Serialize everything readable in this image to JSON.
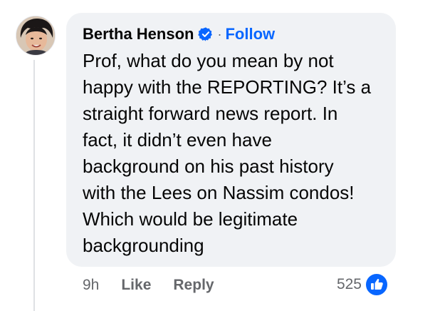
{
  "comment": {
    "author": "Bertha Henson",
    "verified_icon": "verified-badge-icon",
    "separator": "·",
    "follow_label": "Follow",
    "text": "Prof, what do you mean by not\nhappy with the REPORTING? It’s a\nstraight forward news report. In\nfact, it didn’t even have\nbackground on his past history\nwith the Lees on Nassim condos!\nWhich would be legitimate\nbackgrounding",
    "time": "9h",
    "like_label": "Like",
    "reply_label": "Reply",
    "reaction_count": "525",
    "reaction_icon": "thumbs-up-icon"
  },
  "colors": {
    "bubble_bg": "#f0f2f5",
    "accent_blue": "#0866ff",
    "text_primary": "#050505",
    "text_secondary": "#65676b"
  }
}
